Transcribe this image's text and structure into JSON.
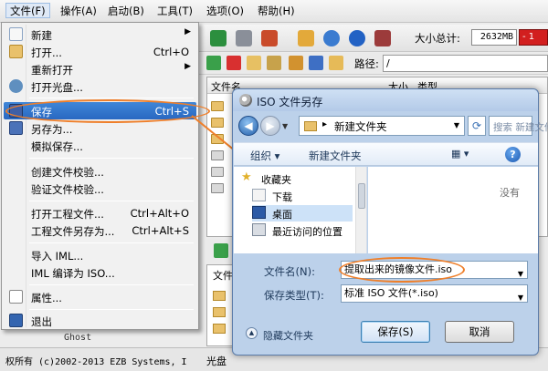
{
  "menubar": {
    "items": [
      "文件(F)",
      "操作(A)",
      "启动(B)",
      "工具(T)",
      "选项(O)",
      "帮助(H)"
    ]
  },
  "toolbar": {
    "size_label": "大小总计:",
    "size_value": "2632MB",
    "size_indicator": "- 1",
    "path_label": "路径:",
    "path_value": "/"
  },
  "list": {
    "col_name": "文件名",
    "col_size": "大小",
    "col_type": "类型",
    "lower_col": "文件"
  },
  "file_menu": {
    "items": [
      {
        "label": "新建",
        "shortcut": "",
        "submenu": true
      },
      {
        "label": "打开...",
        "shortcut": "Ctrl+O",
        "submenu": false
      },
      {
        "label": "重新打开",
        "shortcut": "",
        "submenu": true
      },
      {
        "label": "打开光盘...",
        "shortcut": "",
        "submenu": false
      },
      {
        "label": "保存",
        "shortcut": "Ctrl+S",
        "submenu": false
      },
      {
        "label": "另存为...",
        "shortcut": "",
        "submenu": false
      },
      {
        "label": "模拟保存...",
        "shortcut": "",
        "submenu": false
      },
      {
        "label": "创建文件校验...",
        "shortcut": "",
        "submenu": false
      },
      {
        "label": "验证文件校验...",
        "shortcut": "",
        "submenu": false
      },
      {
        "label": "打开工程文件...",
        "shortcut": "Ctrl+Alt+O",
        "submenu": false
      },
      {
        "label": "工程文件另存为...",
        "shortcut": "Ctrl+Alt+S",
        "submenu": false
      },
      {
        "label": "导入 IML...",
        "shortcut": "",
        "submenu": false
      },
      {
        "label": "IML 编译为 ISO...",
        "shortcut": "",
        "submenu": false
      },
      {
        "label": "属性...",
        "shortcut": "",
        "submenu": false
      },
      {
        "label": "退出",
        "shortcut": "",
        "submenu": false
      }
    ]
  },
  "status": {
    "left": "权所有 (c)2002-2013 EZB Systems, I",
    "right": "光盘",
    "ghost": "Ghost"
  },
  "dialog": {
    "title": "ISO 文件另存",
    "address": "新建文件夹",
    "search_placeholder": "搜索 新建文件夹",
    "organize": "组织",
    "new_folder": "新建文件夹",
    "nav": [
      "收藏夹",
      "下载",
      "桌面",
      "最近访问的位置"
    ],
    "empty": "没有",
    "filename_label": "文件名(N):",
    "filename_value": "提取出来的镜像文件.iso",
    "filetype_label": "保存类型(T):",
    "filetype_value": "标准 ISO 文件(*.iso)",
    "hide_folders": "隐藏文件夹",
    "save": "保存(S)",
    "cancel": "取消"
  },
  "colors": {
    "highlight": "#2968c1",
    "annotation": "#ef7f2a"
  }
}
